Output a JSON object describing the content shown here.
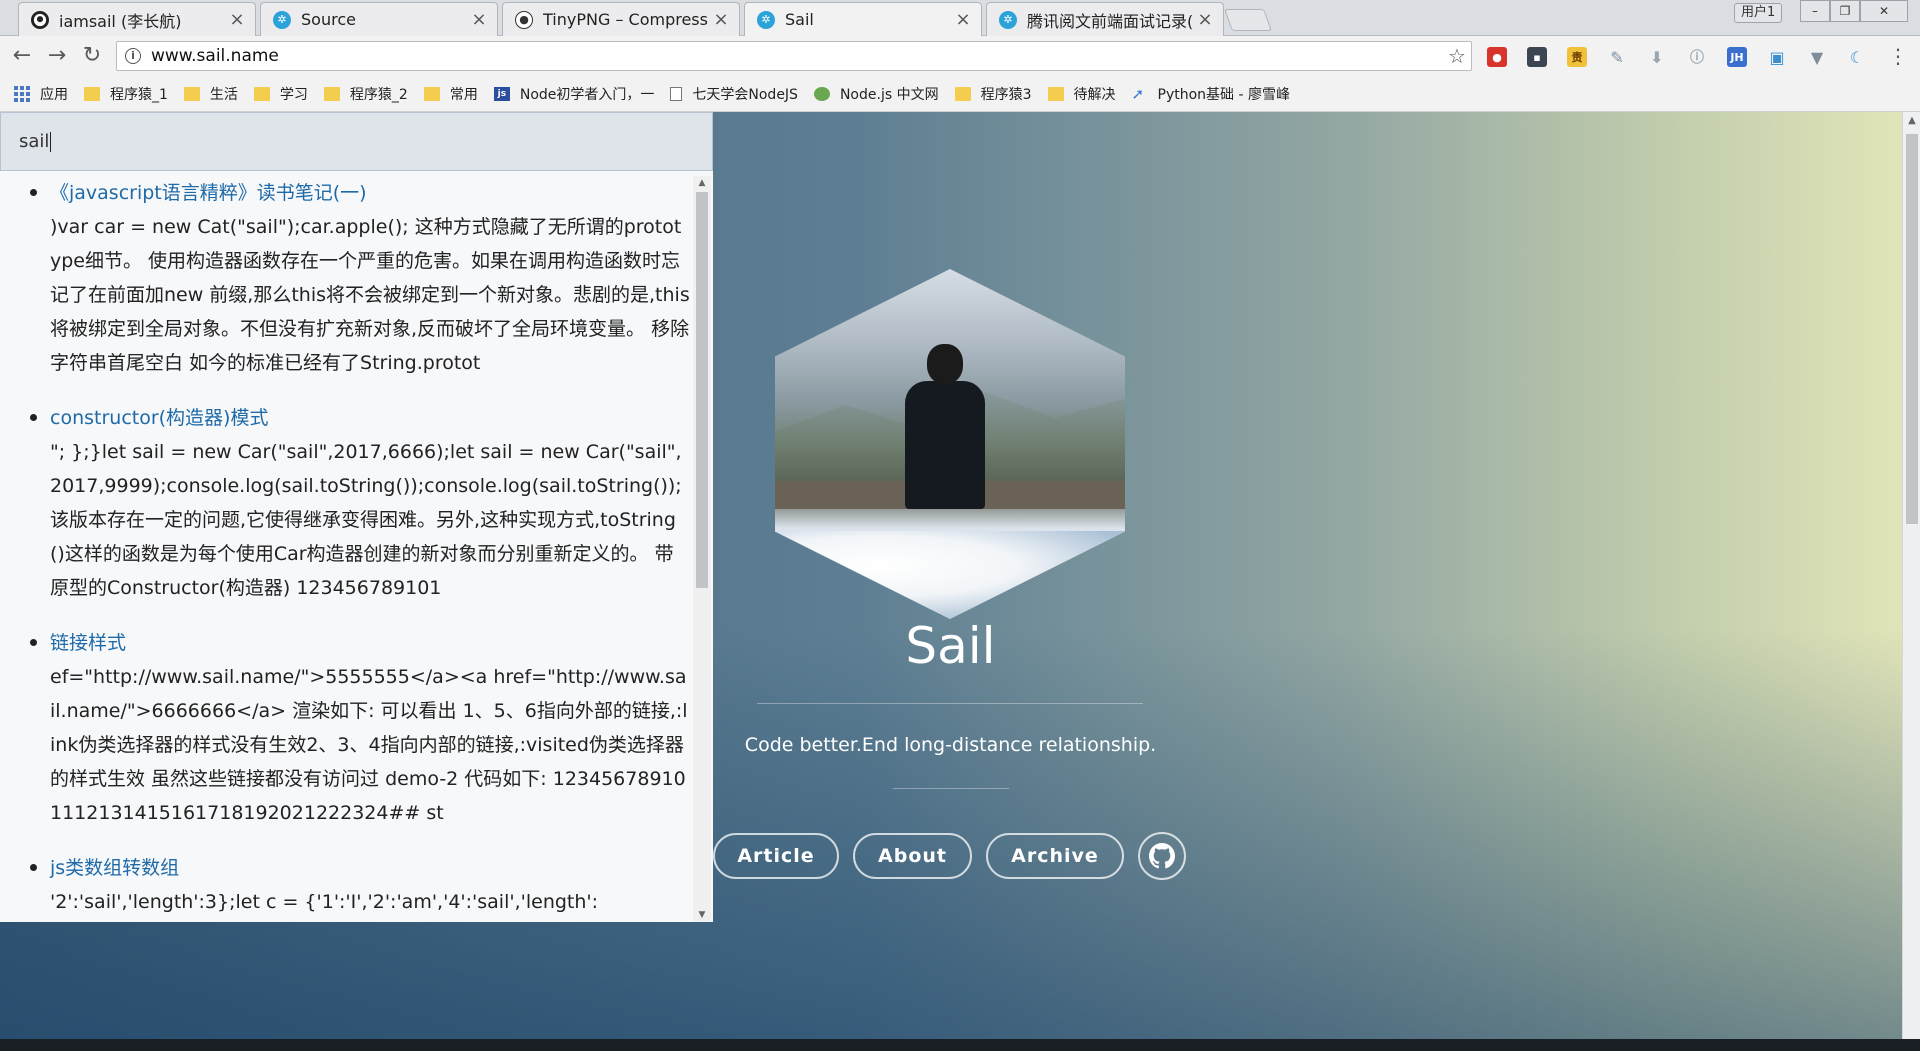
{
  "browser": {
    "tabs": [
      {
        "title": "iamsail (李长航)",
        "icon": "github-icon"
      },
      {
        "title": "Source",
        "icon": "sail-logo-icon"
      },
      {
        "title": "TinyPNG – Compress P",
        "icon": "panda-icon"
      },
      {
        "title": "Sail",
        "icon": "sail-logo-icon",
        "active": true
      },
      {
        "title": "腾讯阅文前端面试记录(",
        "icon": "sail-logo-icon"
      }
    ],
    "user_button": "用户1",
    "url": "www.sail.name"
  },
  "bookmarks": [
    {
      "label": "应用",
      "icon": "apps-grid-icon"
    },
    {
      "label": "程序猿_1",
      "icon": "folder-icon"
    },
    {
      "label": "生活",
      "icon": "folder-icon"
    },
    {
      "label": "学习",
      "icon": "folder-icon"
    },
    {
      "label": "程序猿_2",
      "icon": "folder-icon"
    },
    {
      "label": "常用",
      "icon": "folder-icon"
    },
    {
      "label": "Node初学者入门，一",
      "icon": "js-icon"
    },
    {
      "label": "七天学会NodeJS",
      "icon": "document-icon"
    },
    {
      "label": "Node.js 中文网",
      "icon": "nodejs-icon"
    },
    {
      "label": "程序猿3",
      "icon": "folder-icon"
    },
    {
      "label": "待解决",
      "icon": "folder-icon"
    },
    {
      "label": "Python基础 - 廖雪峰",
      "icon": "rocket-icon"
    }
  ],
  "search": {
    "query": "sail",
    "results": [
      {
        "title": "《javascript语言精粹》读书笔记(一)",
        "snippet": ")var car = new Cat(\"sail\");car.apple(); 这种方式隐藏了无所谓的prototype细节。 使用构造器函数存在一个严重的危害。如果在调用构造函数时忘记了在前面加new 前缀,那么this将不会被绑定到一个新对象。悲剧的是,this将被绑定到全局对象。不但没有扩充新对象,反而破坏了全局环境变量。 移除字符串首尾空白 如今的标准已经有了String.protot"
      },
      {
        "title": "constructor(构造器)模式",
        "snippet": "\"; };}let sail = new Car(\"sail\",2017,6666);let sail = new Car(\"sail\",2017,9999);console.log(sail.toString());console.log(sail.toString()); 该版本存在一定的问题,它使得继承变得困难。另外,这种实现方式,toString()这样的函数是为每个使用Car构造器创建的新对象而分别重新定义的。 带原型的Constructor(构造器) 123456789101"
      },
      {
        "title": "链接样式",
        "snippet": "ef=\"http://www.sail.name/\">5555555</a><a href=\"http://www.sail.name/\">6666666</a> 渲染如下: 可以看出 1、5、6指向外部的链接,:link伪类选择器的样式没有生效2、3、4指向内部的链接,:visited伪类选择器的样式生效 虽然这些链接都没有访问过 demo-2 代码如下: 123456789101112131415161718192021222324## st"
      },
      {
        "title": "js类数组转数组",
        "snippet": "'2':'sail','length':3};let c = {'1':'I','2':'am','4':'sail','length':"
      }
    ]
  },
  "profile": {
    "name": "Sail",
    "tagline": "Code better.End long-distance relationship.",
    "nav": [
      "Article",
      "About",
      "Archive"
    ],
    "github_icon": "github-icon"
  },
  "colors": {
    "link": "#1e6aa8",
    "hero_left": "#3f6079",
    "hero_right": "#e4e6ba"
  }
}
